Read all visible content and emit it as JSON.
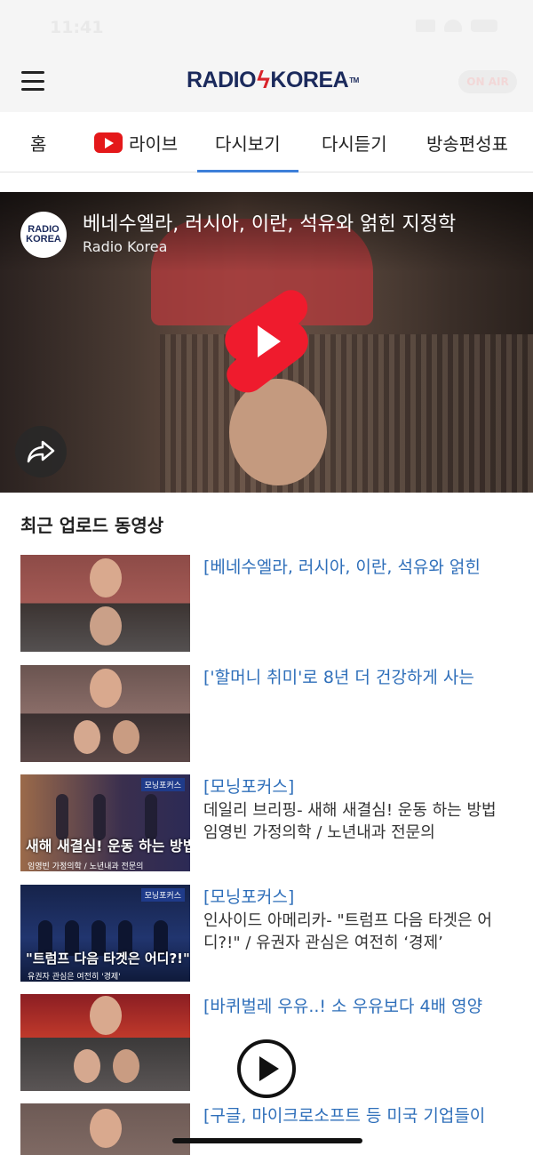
{
  "status_bar": {
    "time": "11:41"
  },
  "header": {
    "logo_left": "RADIO",
    "logo_right": "KOREA",
    "logo_tm": "TM",
    "on_air": "ON AIR"
  },
  "tabs": [
    {
      "label": "홈",
      "active": false
    },
    {
      "label": "라이브",
      "active": false,
      "icon": "youtube-icon"
    },
    {
      "label": "다시보기",
      "active": true
    },
    {
      "label": "다시듣기",
      "active": false
    },
    {
      "label": "방송편성표",
      "active": false
    }
  ],
  "featured_video": {
    "title": "베네수엘라, 러시아, 이란, 석유와 얽힌 지정학",
    "channel": "Radio Korea",
    "channel_logo_line1": "RADIO",
    "channel_logo_line2": "KOREA",
    "icons": {
      "play": "youtube-shorts-icon",
      "share": "share-icon"
    }
  },
  "section_title": "최근 업로드 동영상",
  "videos": [
    {
      "title": "[베네수엘라, 러시아, 이란, 석유와 얽힌",
      "description": ""
    },
    {
      "title": "['할머니 취미'로 8년 더 건강하게 사는",
      "description": ""
    },
    {
      "title": "[모닝포커스]",
      "description": "데일리 브리핑- 새해 새결심! 운동 하는 방법 임영빈 가정의학 / 노년내과 전문의"
    },
    {
      "title": "[모닝포커스]",
      "description": "인사이드 아메리카- \"트럼프 다음 타겟은 어디?!\" / 유권자 관심은 여전히 ‘경제’"
    },
    {
      "title": "[바퀴벌레 우유..! 소 우유보다 4배 영양",
      "description": ""
    },
    {
      "title": "[구글, 마이크로소프트 등 미국 기업들이",
      "description": ""
    }
  ],
  "thumbnail_captions": {
    "v3_main": "새해 새결심! 운동 하는 방법",
    "v3_sub": "임영빈 가정의학 / 노년내과 전문의",
    "v3_tag": "모닝포커스",
    "v4_main": "\"트럼프 다음 타겟은 어디?!\"",
    "v4_sub": "유권자 관심은 여전히 '경제'",
    "v4_tag": "모닝포커스"
  },
  "colors": {
    "accent": "#3d7fd9",
    "link_title": "#2f6fba",
    "brand_navy": "#1b2a5c",
    "brand_red": "#d8232a",
    "youtube_red": "#e4181a"
  }
}
